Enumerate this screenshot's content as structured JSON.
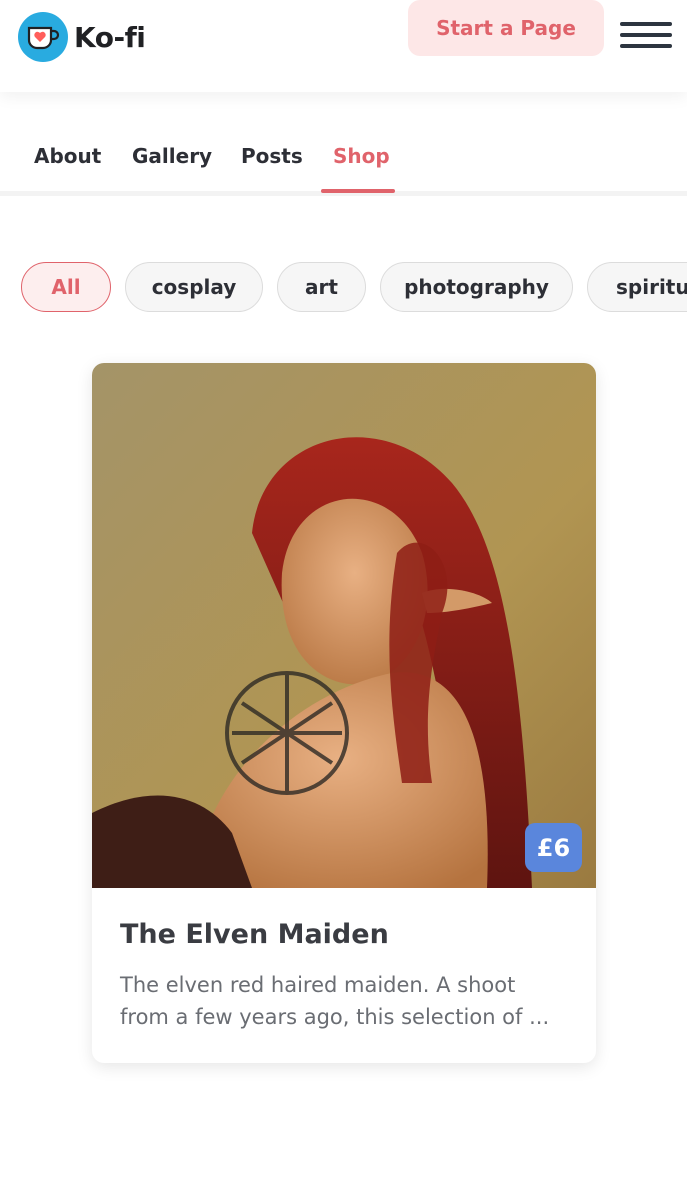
{
  "header": {
    "logo_text": "Ko-fi",
    "start_button_label": "Start a Page"
  },
  "tabs": [
    {
      "label": "About",
      "active": false
    },
    {
      "label": "Gallery",
      "active": false
    },
    {
      "label": "Posts",
      "active": false
    },
    {
      "label": "Shop",
      "active": true
    }
  ],
  "filters": [
    {
      "label": "All",
      "active": true
    },
    {
      "label": "cosplay",
      "active": false
    },
    {
      "label": "art",
      "active": false
    },
    {
      "label": "photography",
      "active": false
    },
    {
      "label": "spiritua",
      "active": false
    }
  ],
  "product": {
    "price": "£6",
    "title": "The Elven Maiden",
    "description": "The elven red haired maiden. A shoot from a few years ago, this selection of ..."
  },
  "colors": {
    "accent": "#e0636b",
    "accent_bg": "#fde7e7",
    "price_badge": "#5a86dc",
    "logo_blue": "#29abe0"
  },
  "icons": {
    "logo": "ko-fi-cup-heart-icon",
    "menu": "hamburger-menu-icon"
  }
}
